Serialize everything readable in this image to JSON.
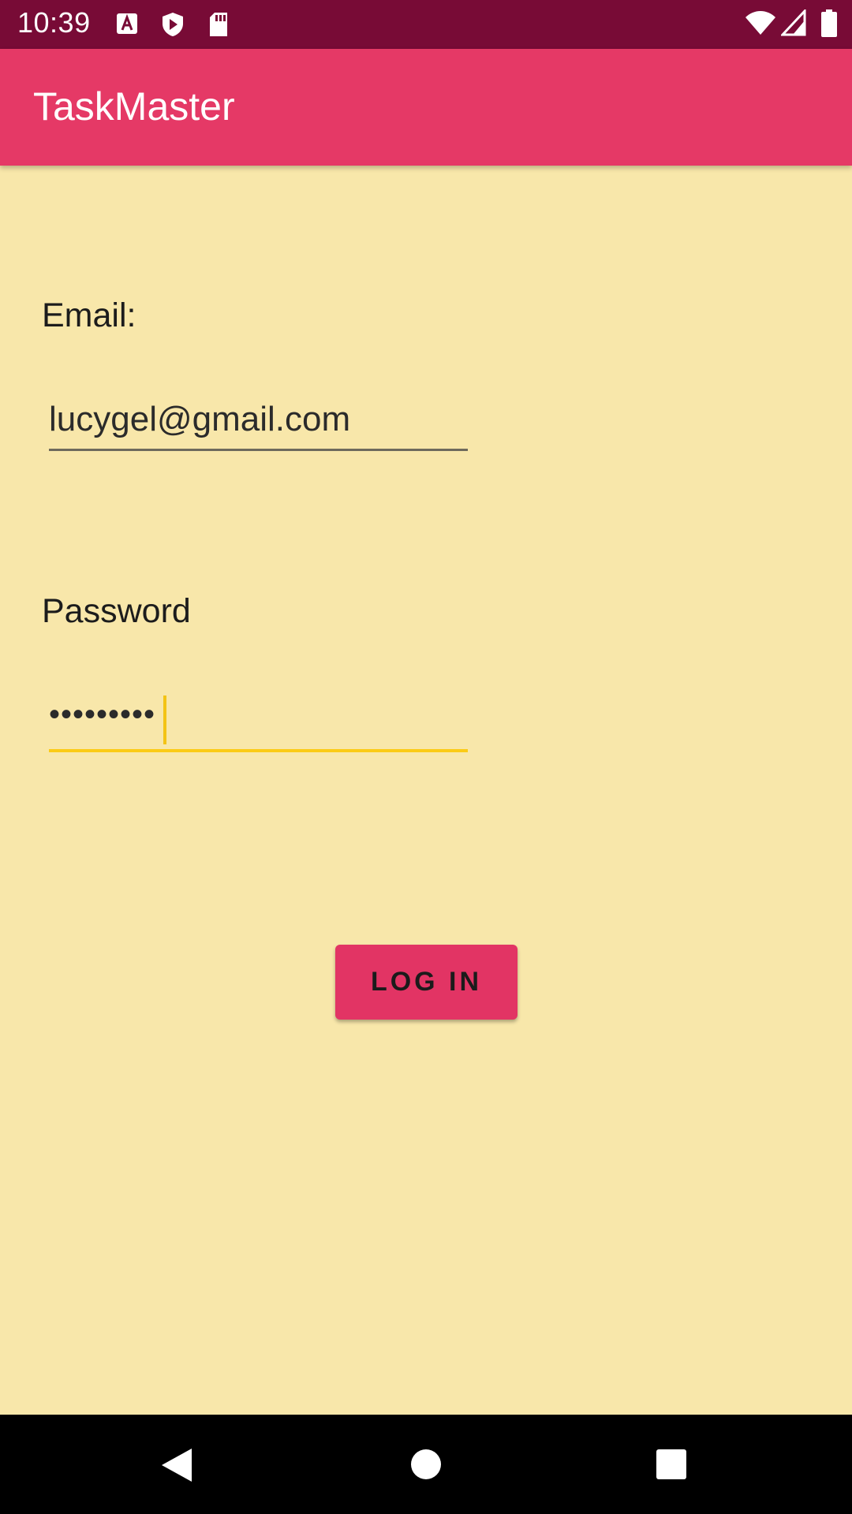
{
  "status_bar": {
    "time": "10:39",
    "left_icons": [
      "a-notification-icon",
      "shield-play-icon",
      "sd-card-icon"
    ],
    "right_icons": [
      "wifi-icon",
      "signal-icon",
      "battery-icon"
    ]
  },
  "app_bar": {
    "title": "TaskMaster"
  },
  "form": {
    "email_label": "Email:",
    "email_value": "lucygel@gmail.com",
    "password_label": "Password",
    "password_value": "•••••••••"
  },
  "login_button": {
    "label": "LOG IN"
  },
  "nav_bar": {
    "icons": [
      "back-icon",
      "home-icon",
      "recents-icon"
    ]
  },
  "colors": {
    "status_bar": "#780b36",
    "app_bar": "#e53966",
    "background": "#f8e7aa",
    "accent": "#fbcb16",
    "button": "#e23464"
  }
}
